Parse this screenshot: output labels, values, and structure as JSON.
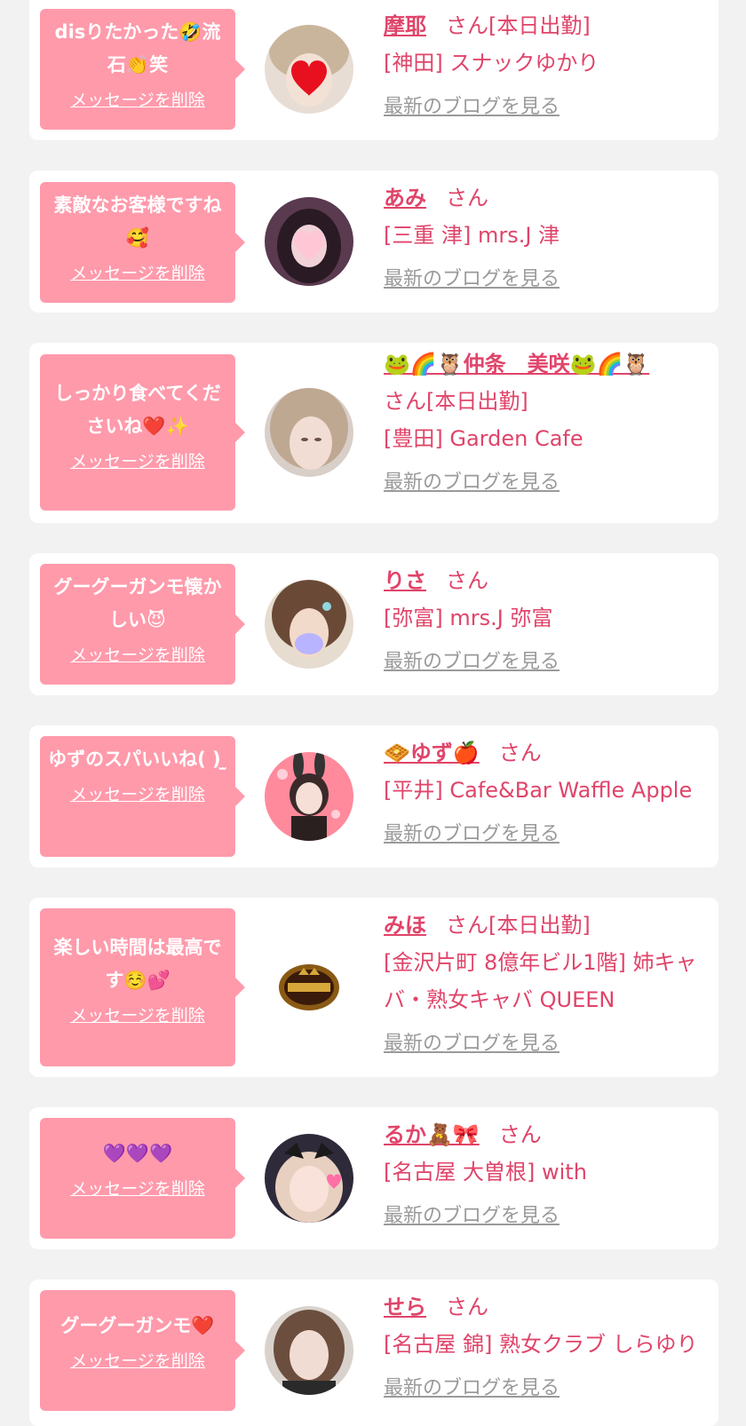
{
  "colors": {
    "accent": "#e0446a",
    "bubble": "#ff9aab",
    "muted": "#9a9a9a",
    "background": "#f2f2f2"
  },
  "common": {
    "delete_label": "メッセージを削除",
    "blog_label": "最新のブログを見る",
    "san": "さん"
  },
  "items": [
    {
      "message": "disりたかった🤣流石👏笑",
      "name": "摩耶",
      "status": "[本日出勤]",
      "shop": "[神田] スナックゆかり"
    },
    {
      "message": "素敵なお客様ですね🥰",
      "name": "あみ",
      "status": "",
      "shop": "[三重 津] mrs.J 津"
    },
    {
      "message": "しっかり食べてくださいね❤️✨",
      "name": "🐸🌈🦉仲条　美咲🐸🌈🦉",
      "status": "[本日出勤]",
      "shop": "[豊田] Garden Cafe"
    },
    {
      "message": "グーグーガンモ懐かしい😈",
      "name": "りさ",
      "status": "",
      "shop": "[弥富] mrs.J 弥富"
    },
    {
      "message": "ゆずのスパいいね( ) ̫ ",
      "name": "🧇ゆず🍎",
      "status": "",
      "shop": "[平井] Cafe&Bar Waffle Apple"
    },
    {
      "message": "楽しい時間は最高です☺️💕",
      "name": "みほ",
      "status": "[本日出勤]",
      "shop": "[金沢片町 8億年ビル1階] 姉キャバ・熟女キャバ QUEEN"
    },
    {
      "message": "💜💜💜",
      "name": "るか🧸🎀",
      "status": "",
      "shop": "[名古屋 大曽根] with"
    },
    {
      "message": "グーグーガンモ❤️",
      "name": "せら",
      "status": "",
      "shop": "[名古屋 錦] 熟女クラブ しらゆり"
    }
  ]
}
